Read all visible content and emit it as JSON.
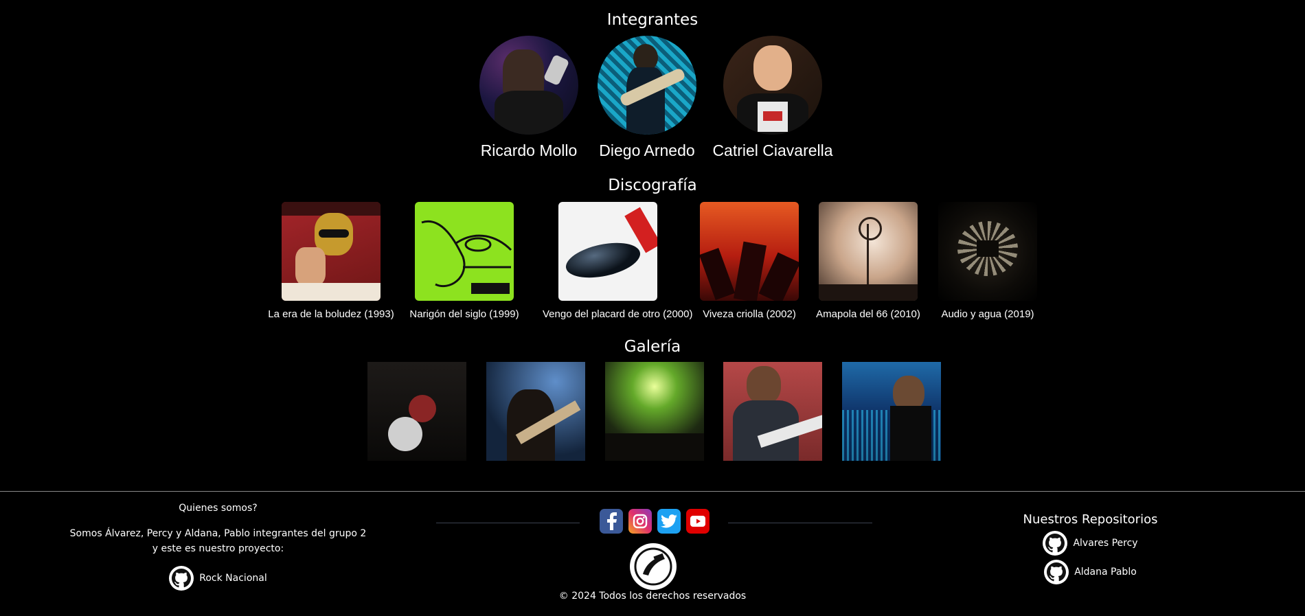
{
  "members": {
    "title": "Integrantes",
    "items": [
      {
        "name": "Ricardo Mollo"
      },
      {
        "name": "Diego Arnedo"
      },
      {
        "name": "Catriel Ciavarella"
      }
    ]
  },
  "discography": {
    "title": "Discografía",
    "items": [
      {
        "label": "La era de la boludez (1993)"
      },
      {
        "label": "Narigón del siglo (1999)"
      },
      {
        "label": "Vengo del placard de otro (2000)"
      },
      {
        "label": "Viveza criolla (2002)"
      },
      {
        "label": "Amapola del 66 (2010)"
      },
      {
        "label": "Audio y agua (2019)"
      }
    ]
  },
  "gallery": {
    "title": "Galería"
  },
  "footer": {
    "who_title": "Quienes somos?",
    "who_line1": "Somos Álvarez, Percy y Aldana, Pablo integrantes del grupo 2",
    "who_line2": "y este es nuestro proyecto:",
    "project_link": "Rock Nacional",
    "repos_title": "Nuestros Repositorios",
    "repo1": "Alvares Percy",
    "repo2": "Aldana Pablo",
    "copyright": "© 2024 Todos los derechos reservados",
    "social": [
      "facebook-icon",
      "instagram-icon",
      "twitter-icon",
      "youtube-icon"
    ]
  }
}
